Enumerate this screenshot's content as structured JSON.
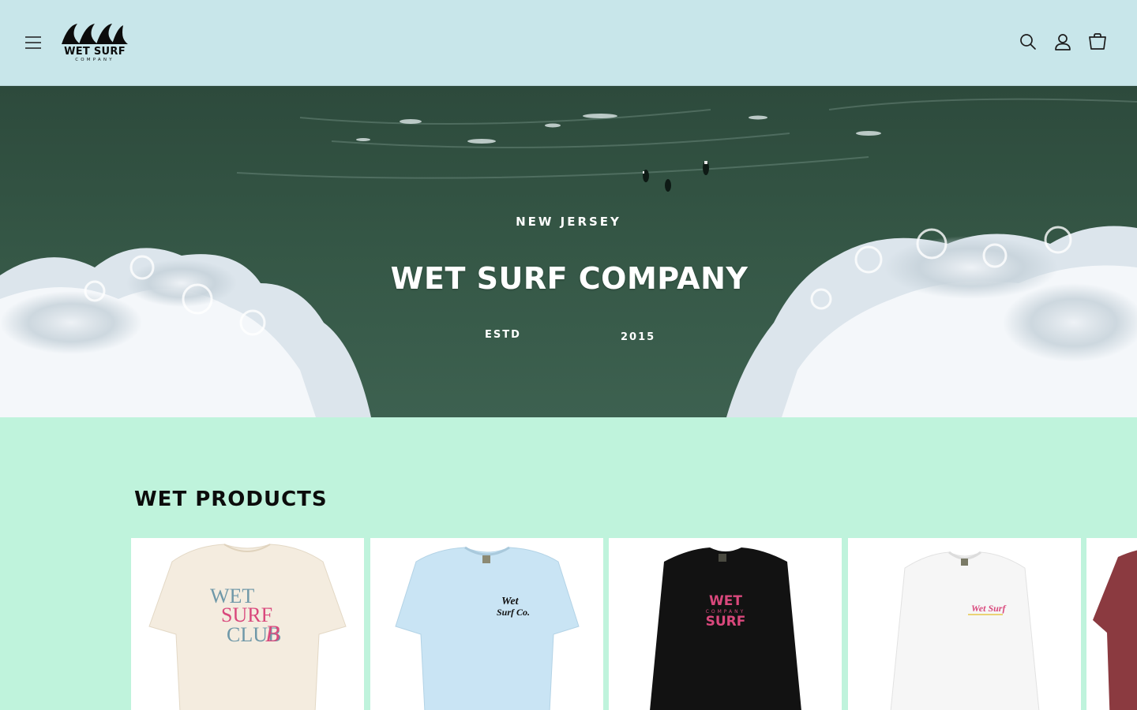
{
  "header": {
    "logo": {
      "word": "WET SURF",
      "sub": "COMPANY"
    },
    "icons": [
      "menu-icon",
      "search-icon",
      "account-icon",
      "cart-icon"
    ]
  },
  "hero": {
    "kicker": "NEW JERSEY",
    "title": "WET SURF COMPANY",
    "estd_label": "ESTD",
    "year": "2015"
  },
  "products_section": {
    "title": "WET PRODUCTS",
    "products": [
      {
        "shirt_color": "#f4ecdf",
        "print": [
          "WET",
          "SURF",
          "CLUB"
        ],
        "monogram": "B"
      },
      {
        "shirt_color": "#c9e4f4",
        "print": [
          "Wet",
          "Surf Co."
        ]
      },
      {
        "shirt_color": "#121212",
        "print": [
          "WET",
          "COMPANY",
          "SURF"
        ]
      },
      {
        "shirt_color": "#f6f6f6",
        "print": [
          "Wet Surf"
        ]
      },
      {
        "shirt_color": "#8b3a40"
      }
    ]
  },
  "colors": {
    "header_bg": "#c8e6ea",
    "page_bg": "#bff3dc",
    "ink": "#0c0c0c",
    "accent_pink": "#d9487c"
  }
}
